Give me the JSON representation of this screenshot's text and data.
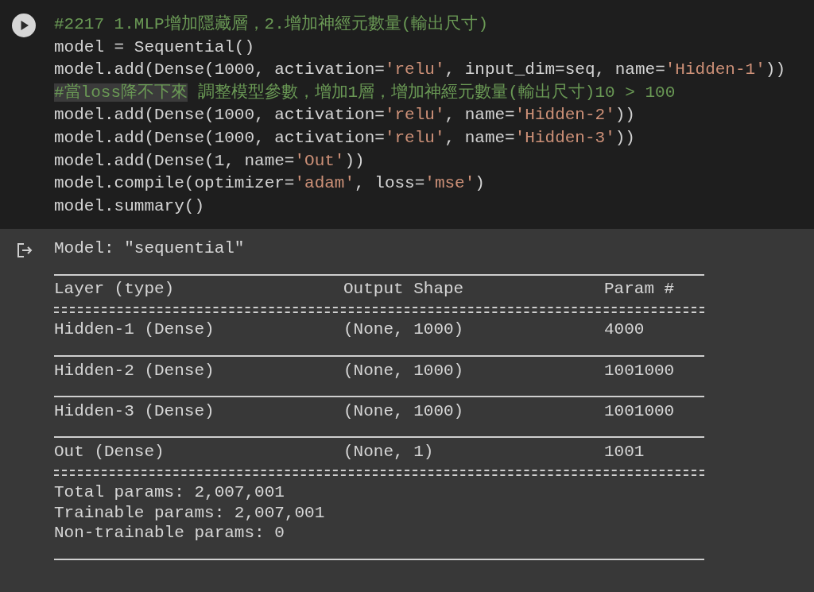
{
  "code_cell": {
    "lines": [
      {
        "segments": [
          {
            "text": "#2217 1.MLP增加隱藏層，2.增加神經元數量(輸出尺寸)",
            "kind": "comment",
            "highlighted": false
          }
        ]
      },
      {
        "segments": [
          {
            "text": "model = Sequential()",
            "kind": "plain",
            "highlighted": false
          }
        ]
      },
      {
        "segments": [
          {
            "text": "model.add(Dense(1000, activation=",
            "kind": "plain",
            "highlighted": false
          },
          {
            "text": "'relu'",
            "kind": "string",
            "highlighted": false
          },
          {
            "text": ", input_dim=seq, name=",
            "kind": "plain",
            "highlighted": false
          },
          {
            "text": "'Hidden-1'",
            "kind": "string",
            "highlighted": false
          },
          {
            "text": "))",
            "kind": "plain",
            "highlighted": false
          }
        ]
      },
      {
        "segments": [
          {
            "text": "#當loss降不下來",
            "kind": "comment",
            "highlighted": true
          },
          {
            "text": " 調整模型參數，增加1層，增加神經元數量(輸出尺寸)10 > 100",
            "kind": "comment",
            "highlighted": false
          }
        ]
      },
      {
        "segments": [
          {
            "text": "model.add(Dense(1000, activation=",
            "kind": "plain",
            "highlighted": false
          },
          {
            "text": "'relu'",
            "kind": "string",
            "highlighted": false
          },
          {
            "text": ", name=",
            "kind": "plain",
            "highlighted": false
          },
          {
            "text": "'Hidden-2'",
            "kind": "string",
            "highlighted": false
          },
          {
            "text": "))",
            "kind": "plain",
            "highlighted": false
          }
        ]
      },
      {
        "segments": [
          {
            "text": "model.add(Dense(1000, activation=",
            "kind": "plain",
            "highlighted": false
          },
          {
            "text": "'relu'",
            "kind": "string",
            "highlighted": false
          },
          {
            "text": ", name=",
            "kind": "plain",
            "highlighted": false
          },
          {
            "text": "'Hidden-3'",
            "kind": "string",
            "highlighted": false
          },
          {
            "text": "))",
            "kind": "plain",
            "highlighted": false
          }
        ]
      },
      {
        "segments": [
          {
            "text": "model.add(Dense(1, name=",
            "kind": "plain",
            "highlighted": false
          },
          {
            "text": "'Out'",
            "kind": "string",
            "highlighted": false
          },
          {
            "text": "))",
            "kind": "plain",
            "highlighted": false
          }
        ]
      },
      {
        "segments": [
          {
            "text": "model.compile(optimizer=",
            "kind": "plain",
            "highlighted": false
          },
          {
            "text": "'adam'",
            "kind": "string",
            "highlighted": false
          },
          {
            "text": ", loss=",
            "kind": "plain",
            "highlighted": false
          },
          {
            "text": "'mse'",
            "kind": "string",
            "highlighted": false
          },
          {
            "text": ")",
            "kind": "plain",
            "highlighted": false
          }
        ]
      },
      {
        "segments": [
          {
            "text": "model.summary()",
            "kind": "plain",
            "highlighted": false
          }
        ]
      }
    ]
  },
  "output": {
    "model_line": "Model: \"sequential\"",
    "columns": [
      "Layer (type)",
      "Output Shape",
      "Param #"
    ],
    "rows": [
      {
        "layer": "Hidden-1 (Dense)",
        "shape": "(None, 1000)",
        "params": "4000"
      },
      {
        "layer": "Hidden-2 (Dense)",
        "shape": "(None, 1000)",
        "params": "1001000"
      },
      {
        "layer": "Hidden-3 (Dense)",
        "shape": "(None, 1000)",
        "params": "1001000"
      },
      {
        "layer": "Out (Dense)",
        "shape": "(None, 1)",
        "params": "1001"
      }
    ],
    "totals": [
      "Total params: 2,007,001",
      "Trainable params: 2,007,001",
      "Non-trainable params: 0"
    ]
  }
}
